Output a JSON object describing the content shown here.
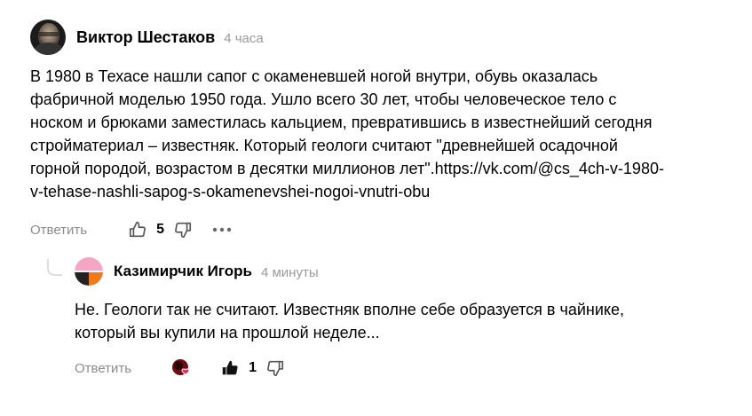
{
  "comment": {
    "author": "Виктор Шестаков",
    "time": "4 часа",
    "text_lines": [
      "В 1980 в Техасе нашли сапог с окаменевшей ногой внутри, обувь оказалась",
      "фабричной моделью 1950 года. Ушло всего 30 лет, чтобы человеческое тело с",
      "носком и брюками заместилась кальцием, превратившись в известнейший сегодня",
      "стройматериал – известняк. Который геологи считают \"древнейшей осадочной",
      "горной породой, возрастом в десятки миллионов лет\".https://vk.com/@cs_4ch-v-1980-",
      "v-tehase-nashli-sapog-s-okamenevshei-nogoi-vnutri-obu"
    ],
    "reply_label": "Ответить",
    "likes": "5",
    "icons": {
      "like": "thumbs-up-icon",
      "dislike": "thumbs-down-icon",
      "more": "more-dots-icon"
    }
  },
  "reply": {
    "author": "Казимирчик Игорь",
    "time": "4 минуты",
    "text_lines": [
      "Не. Геологи так не считают. Известняк вполне себе образуется в чайнике,",
      "который вы купили на прошлой неделе..."
    ],
    "reply_label": "Ответить",
    "likes": "1",
    "icons": {
      "like": "thumbs-up-filled-icon",
      "dislike": "thumbs-down-icon",
      "reaction": "reaction-heart-icon"
    }
  },
  "colors": {
    "muted": "#8c8c8c",
    "icon": "#555555",
    "text": "#000000"
  }
}
